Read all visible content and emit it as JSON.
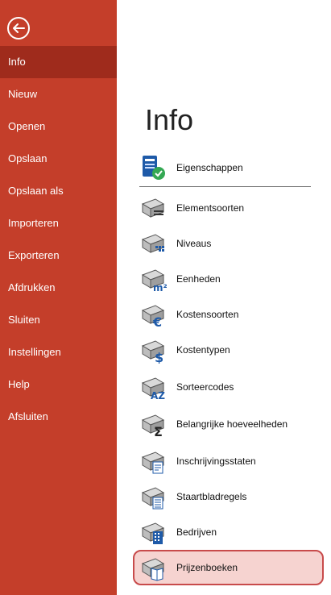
{
  "sidebar": {
    "items": [
      {
        "label": "Info",
        "selected": true
      },
      {
        "label": "Nieuw"
      },
      {
        "label": "Openen"
      },
      {
        "label": "Opslaan"
      },
      {
        "label": "Opslaan als"
      },
      {
        "label": "Importeren"
      },
      {
        "label": "Exporteren"
      },
      {
        "label": "Afdrukken"
      },
      {
        "label": "Sluiten"
      },
      {
        "label": "Instellingen"
      },
      {
        "label": "Help"
      },
      {
        "label": "Afsluiten"
      }
    ]
  },
  "main": {
    "title": "Info",
    "commands": [
      {
        "label": "Eigenschappen"
      },
      {
        "label": "Elementsoorten"
      },
      {
        "label": "Niveaus"
      },
      {
        "label": "Eenheden"
      },
      {
        "label": "Kostensoorten"
      },
      {
        "label": "Kostentypen"
      },
      {
        "label": "Sorteercodes"
      },
      {
        "label": "Belangrijke hoeveelheden"
      },
      {
        "label": "Inschrijvingsstaten"
      },
      {
        "label": "Staartbladregels"
      },
      {
        "label": "Bedrijven"
      },
      {
        "label": "Prijzenboeken"
      }
    ]
  },
  "colors": {
    "sidebar_bg": "#c43e2a",
    "sidebar_selected": "#9f2b1c",
    "highlight_border": "#c84b4b",
    "highlight_fill": "#f6d3d0"
  }
}
